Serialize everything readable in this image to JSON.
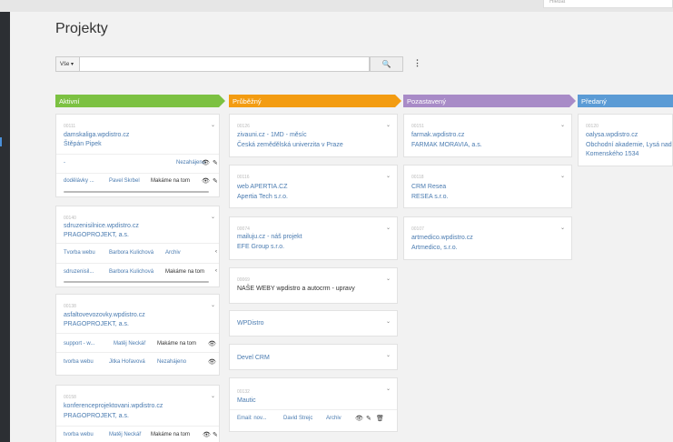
{
  "top": {
    "search_placeholder": "Hledat"
  },
  "page": {
    "title": "Projekty"
  },
  "filter": {
    "dropdown_label": "Vše ▾",
    "search_button": "🔍",
    "menu_icon": "⋮"
  },
  "stages": [
    {
      "label": "Aktivní",
      "color": "#7cc142"
    },
    {
      "label": "Průběžný",
      "color": "#f39c12"
    },
    {
      "label": "Pozastavený",
      "color": "#a88bc7"
    },
    {
      "label": "Předaný",
      "color": "#5b9bd5"
    }
  ],
  "col1": {
    "c1": {
      "num": "00111",
      "title": "damskaliga.wpdistro.cz",
      "sub": "Štěpán Pipek",
      "r1": {
        "a": "-",
        "b": "",
        "c": "Nezahájeno"
      },
      "r2": {
        "a": "dodělávky ...",
        "b": "Pavel Skrbel",
        "c": "Makáme na tom"
      }
    },
    "c2": {
      "num": "00140",
      "title": "sdruzenisilnice.wpdistro.cz",
      "sub": "PRAGOPROJEKT, a.s.",
      "r1": {
        "a": "Tvorba webu",
        "b": "Barbora Kulichová",
        "c": "Archiv"
      },
      "r2": {
        "a": "sdruzenisil...",
        "b": "Barbora Kulichová",
        "c": "Makáme na tom"
      }
    },
    "c3": {
      "num": "00138",
      "title": "asfaltovevozovky.wpdistro.cz",
      "sub": "PRAGOPROJEKT, a.s.",
      "r1": {
        "a": "support - w...",
        "b": "Matěj Neckář",
        "c": "Makáme na tom"
      },
      "r2": {
        "a": "tvorba webu",
        "b": "Jitka Hořavová",
        "c": "Nezahájeno"
      }
    },
    "c4": {
      "num": "00158",
      "title": "konferenceprojektovani.wpdistro.cz",
      "sub": "PRAGOPROJEKT, a.s.",
      "r1": {
        "a": "tvorba webu",
        "b": "Matěj Neckář",
        "c": "Makáme na tom"
      }
    }
  },
  "col2": {
    "c1": {
      "num": "00126",
      "title": "zivauni.cz - 1MD - měsíc",
      "sub": "Česká zemědělská univerzita v Praze"
    },
    "c2": {
      "num": "00116",
      "title": "web APERTIA.CZ",
      "sub": "Apertia Tech s.r.o."
    },
    "c3": {
      "num": "00074",
      "title": "mailuju.cz - náš projekt",
      "sub": "EFE Group s.r.o."
    },
    "c4": {
      "num": "00069",
      "title": "NAŠE WEBY wpdistro a autocrm - upravy"
    },
    "c5": {
      "title": "WPDistro"
    },
    "c6": {
      "title": "Devel CRM"
    },
    "c7": {
      "num": "00132",
      "title": "Mautic",
      "r1": {
        "a": "Email: nov...",
        "b": "David Strejc",
        "c": "Archiv"
      }
    }
  },
  "col3": {
    "c1": {
      "num": "00151",
      "title": "farmak.wpdistro.cz",
      "sub": "FARMAK MORAVIA, a.s."
    },
    "c2": {
      "num": "00118",
      "title": "CRM Resea",
      "sub": "RESEA s.r.o."
    },
    "c3": {
      "num": "00107",
      "title": "artmedico.wpdistro.cz",
      "sub": "Artmedico, s.r.o."
    }
  },
  "col4": {
    "c1": {
      "num": "00120",
      "title": "oalysa.wpdistro.cz",
      "sub": "Obchodní akademie, Lysá nad",
      "sub2": "Komenského 1534"
    }
  }
}
